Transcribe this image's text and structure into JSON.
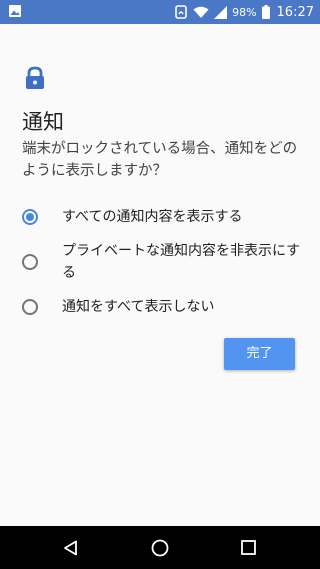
{
  "status_bar": {
    "battery": "98%",
    "time": "16:27",
    "icons": [
      "image-notification-icon",
      "nfc-icon",
      "wifi-icon",
      "signal-icon",
      "battery-icon"
    ]
  },
  "screen": {
    "icon": "lock-icon",
    "title": "通知",
    "subtitle": "端末がロックされている場合、通知をどのように表示しますか？"
  },
  "options": [
    {
      "label": "すべての通知内容を表示する",
      "selected": true
    },
    {
      "label": "プライベートな通知内容を非表示にする",
      "selected": false
    },
    {
      "label": "通知をすべて表示しない",
      "selected": false
    }
  ],
  "done_button": {
    "label": "完了"
  },
  "nav_bar": {
    "icons": [
      "back-icon",
      "home-icon",
      "recents-icon"
    ]
  },
  "colors": {
    "status_bar": "#4a78c7",
    "accent": "#4a86e0",
    "button": "#5294f0"
  }
}
